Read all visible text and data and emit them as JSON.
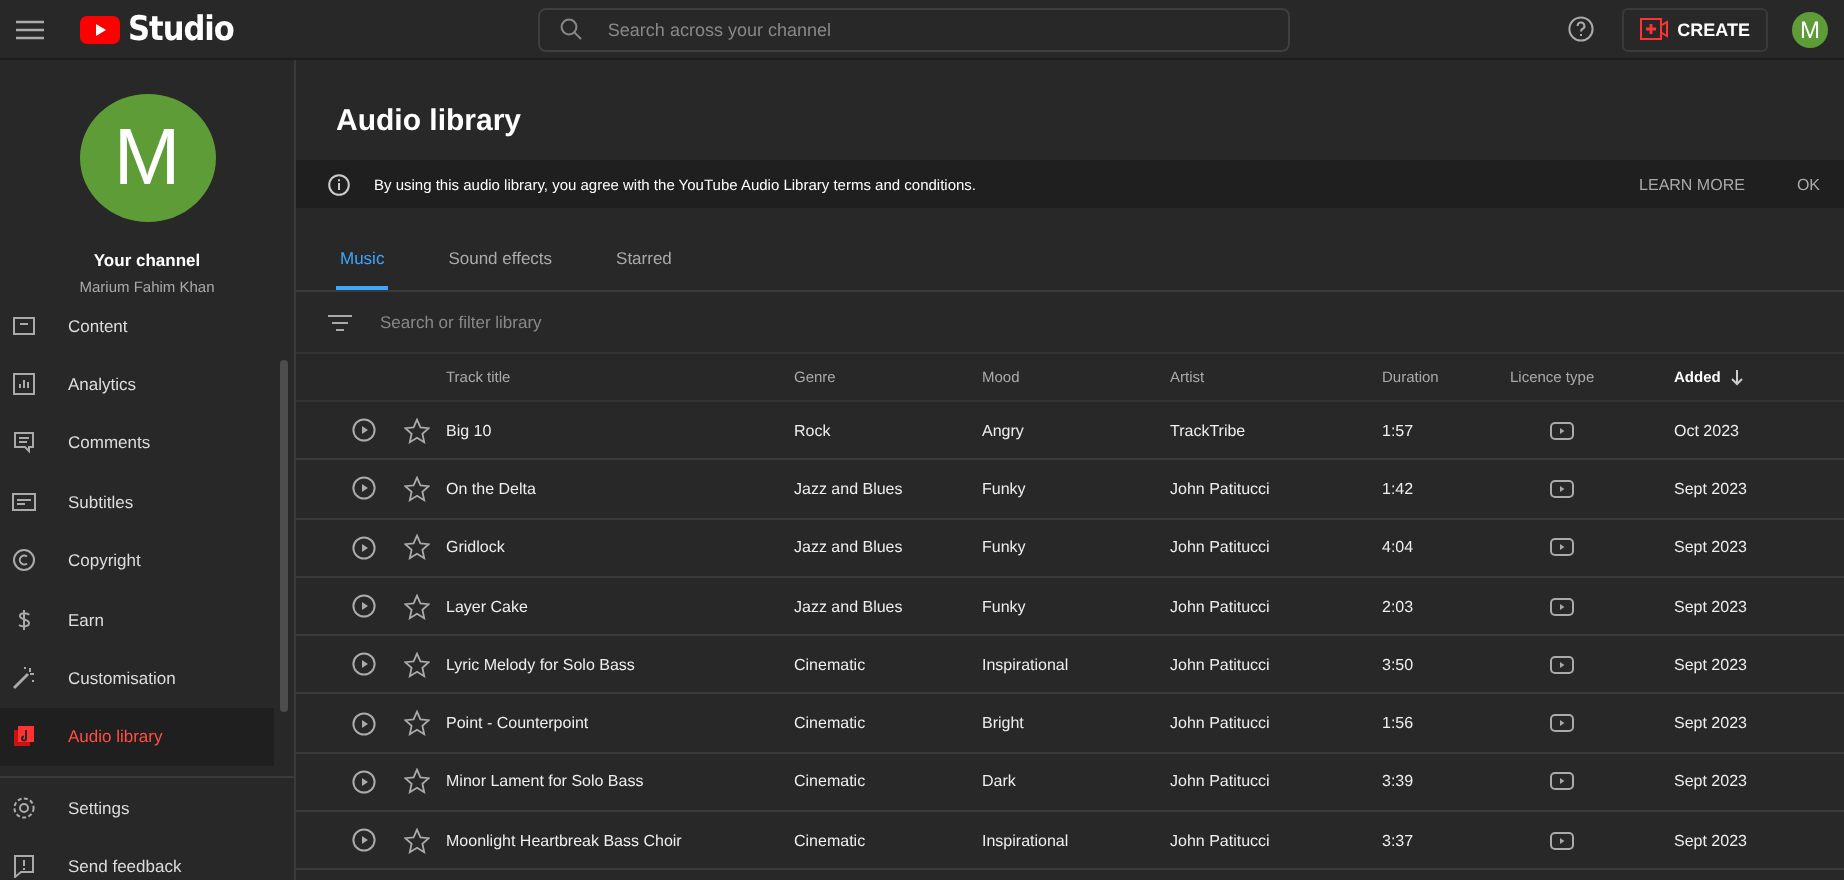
{
  "topbar": {
    "logo_text": "Studio",
    "search": {
      "placeholder": "Search across your channel"
    },
    "create_label": "CREATE",
    "avatar_letter": "M"
  },
  "sidebar": {
    "avatar_letter": "M",
    "channel_title": "Your channel",
    "channel_name": "Marium Fahim Khan",
    "items": [
      {
        "label": "Content",
        "selected": false
      },
      {
        "label": "Analytics",
        "selected": false
      },
      {
        "label": "Comments",
        "selected": false
      },
      {
        "label": "Subtitles",
        "selected": false
      },
      {
        "label": "Copyright",
        "selected": false
      },
      {
        "label": "Earn",
        "selected": false
      },
      {
        "label": "Customisation",
        "selected": false
      },
      {
        "label": "Audio library",
        "selected": true
      }
    ],
    "footer_items": [
      {
        "label": "Settings"
      },
      {
        "label": "Send feedback"
      }
    ]
  },
  "page_title": "Audio library",
  "banner": {
    "text": "By using this audio library, you agree with the YouTube Audio Library terms and conditions.",
    "actions": [
      "LEARN MORE",
      "OK"
    ]
  },
  "tabs": [
    {
      "label": "Music",
      "selected": true
    },
    {
      "label": "Sound effects",
      "selected": false
    },
    {
      "label": "Starred",
      "selected": false
    }
  ],
  "filter": {
    "placeholder": "Search or filter library"
  },
  "table": {
    "columns": [
      {
        "label": "Track title",
        "sorted": false
      },
      {
        "label": "Genre",
        "sorted": false
      },
      {
        "label": "Mood",
        "sorted": false
      },
      {
        "label": "Artist",
        "sorted": false
      },
      {
        "label": "Duration",
        "sorted": false
      },
      {
        "label": "Licence type",
        "sorted": false
      },
      {
        "label": "Added",
        "sorted": true
      }
    ],
    "rows": [
      {
        "title": "Big 10",
        "genre": "Rock",
        "mood": "Angry",
        "artist": "TrackTribe",
        "duration": "1:57",
        "added": "Oct 2023",
        "starred": false
      },
      {
        "title": "On the Delta",
        "genre": "Jazz and Blues",
        "mood": "Funky",
        "artist": "John Patitucci",
        "duration": "1:42",
        "added": "Sept 2023",
        "starred": false
      },
      {
        "title": "Gridlock",
        "genre": "Jazz and Blues",
        "mood": "Funky",
        "artist": "John Patitucci",
        "duration": "4:04",
        "added": "Sept 2023",
        "starred": false
      },
      {
        "title": "Layer Cake",
        "genre": "Jazz and Blues",
        "mood": "Funky",
        "artist": "John Patitucci",
        "duration": "2:03",
        "added": "Sept 2023",
        "starred": false
      },
      {
        "title": "Lyric Melody for Solo Bass",
        "genre": "Cinematic",
        "mood": "Inspirational",
        "artist": "John Patitucci",
        "duration": "3:50",
        "added": "Sept 2023",
        "starred": false
      },
      {
        "title": "Point - Counterpoint",
        "genre": "Cinematic",
        "mood": "Bright",
        "artist": "John Patitucci",
        "duration": "1:56",
        "added": "Sept 2023",
        "starred": false
      },
      {
        "title": "Minor Lament for Solo Bass",
        "genre": "Cinematic",
        "mood": "Dark",
        "artist": "John Patitucci",
        "duration": "3:39",
        "added": "Sept 2023",
        "starred": false
      },
      {
        "title": "Moonlight Heartbreak Bass Choir",
        "genre": "Cinematic",
        "mood": "Inspirational",
        "artist": "John Patitucci",
        "duration": "3:37",
        "added": "Sept 2023",
        "starred": false
      }
    ]
  }
}
